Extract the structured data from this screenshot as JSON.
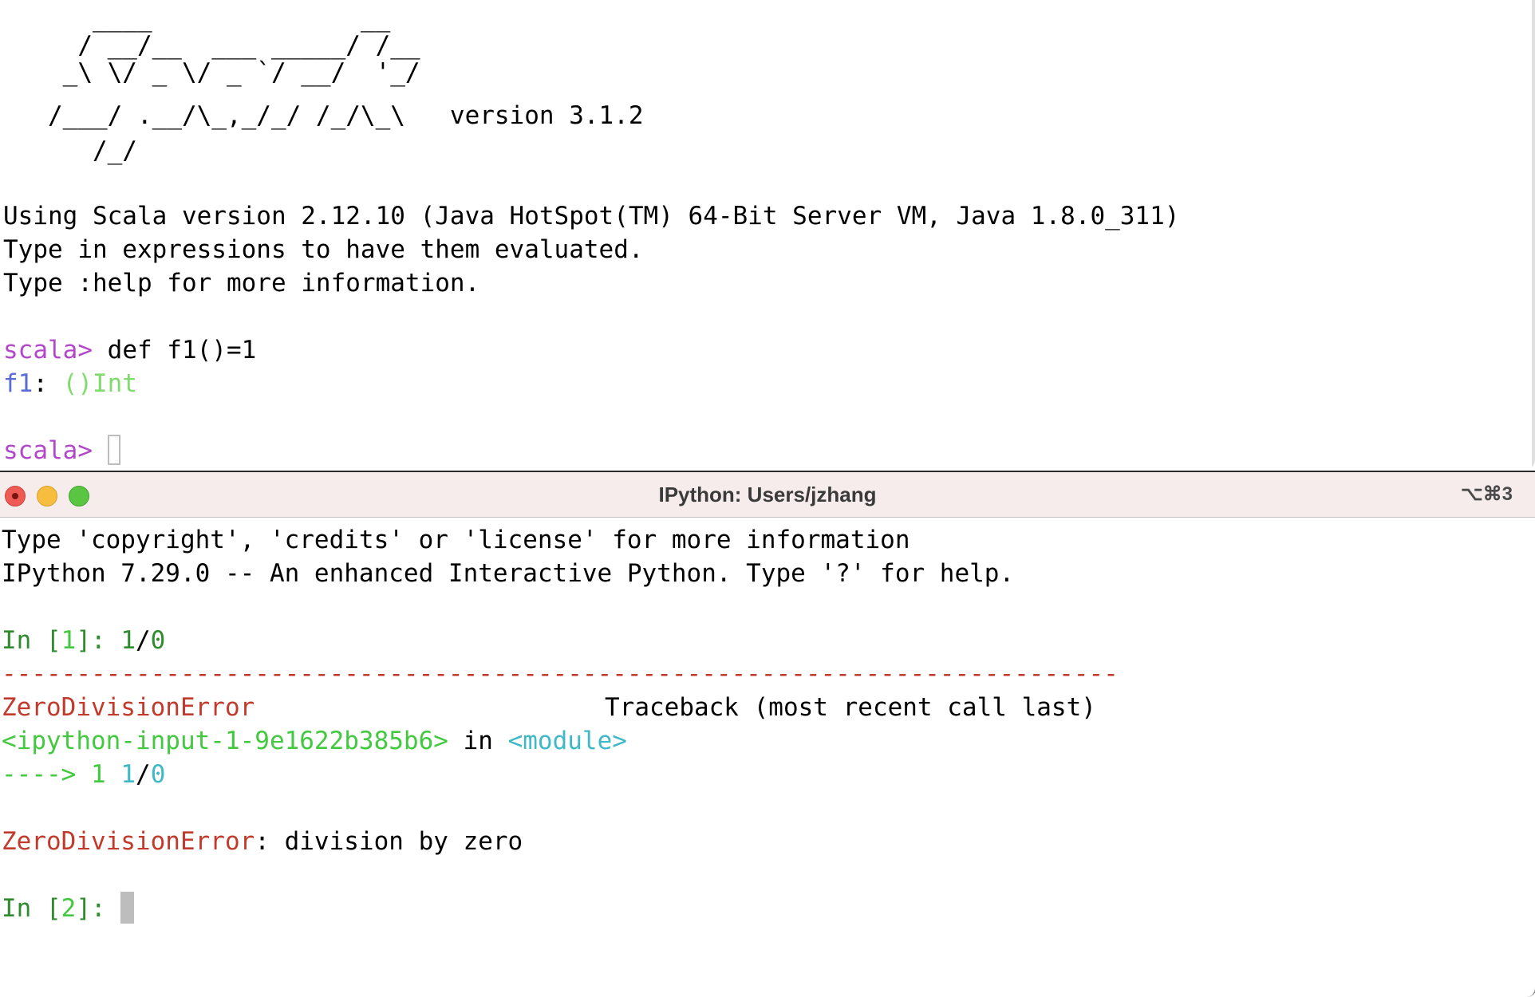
{
  "scala_terminal": {
    "banner": [
      "      ____              __",
      "     / __/__  ___ _____/ /__",
      "    _\\ \\/ _ \\/ _ `/ __/  '_/",
      "   /___/ .__/\\_,_/_/ /_/\\_\\   version 3.1.2",
      "      /_/"
    ],
    "info_lines": [
      "Using Scala version 2.12.10 (Java HotSpot(TM) 64-Bit Server VM, Java 1.8.0_311)",
      "Type in expressions to have them evaluated.",
      "Type :help for more information."
    ],
    "prompt": "scala>",
    "command": "def f1()=1",
    "result_name": "f1",
    "result_sep": ":",
    "result_type": "()Int"
  },
  "ipython_window": {
    "title": "IPython: Users/jzhang",
    "shortcut": "⌥⌘3",
    "header_lines": [
      "Type 'copyright', 'credits' or 'license' for more information",
      "IPython 7.29.0 -- An enhanced Interactive Python. Type '?' for help."
    ],
    "in1_prefix": "In [",
    "in1_num": "1",
    "in1_suffix": "]:",
    "in1_code_a": "1",
    "in1_code_b": "/",
    "in1_code_c": "0",
    "separator": "---------------------------------------------------------------------------",
    "error_name": "ZeroDivisionError",
    "traceback_label": "Traceback (most recent call last)",
    "input_ref": "<ipython-input-1-9e1622b385b6>",
    "in_word": "in",
    "module_ref": "<module>",
    "arrow": "---->",
    "arrow_lineno": "1",
    "arrow_code_a": "1",
    "arrow_code_b": "/",
    "arrow_code_c": "0",
    "final_error_name": "ZeroDivisionError",
    "final_error_msg": ": division by zero",
    "in2_prefix": "In [",
    "in2_num": "2",
    "in2_suffix": "]:"
  }
}
